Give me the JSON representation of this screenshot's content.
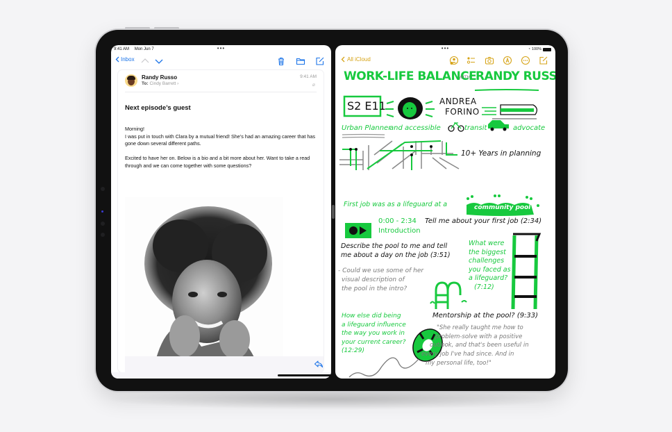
{
  "mail": {
    "status_time": "9:41 AM",
    "status_date": "Mon Jun 7",
    "multitask_dots": "•••",
    "toolbar": {
      "back_label": "Inbox",
      "prev_icon": "chevron-up-icon",
      "next_icon": "chevron-down-icon",
      "trash_icon": "trash-icon",
      "folder_icon": "folder-icon",
      "compose_icon": "compose-icon"
    },
    "message": {
      "sender": "Randy Russo",
      "to_label": "To:",
      "recipient": "Cindy Barrett",
      "time": "9:41 AM",
      "subject": "Next episode’s guest",
      "paragraphs": [
        "Morning!\nI was put in touch with Clara by a mutual friend! She’s had an amazing career that has gone down several different paths.",
        "Excited to have her on. Below is a bio and a bit more about her. Want to take a read through and we can come together with some questions?"
      ],
      "reply_icon": "reply-icon"
    }
  },
  "notes": {
    "multitask_dots": "•••",
    "battery": "100%",
    "toolbar": {
      "back_label": "All iCloud",
      "collab_icon": "collaborate-icon",
      "checklist_icon": "checklist-icon",
      "camera_icon": "camera-icon",
      "markup_icon": "markup-icon",
      "more_icon": "more-icon",
      "compose_icon": "compose-icon"
    },
    "sketch": {
      "title": "WORK-LIFE BALANCE",
      "with": "WITH",
      "host": "RANDY RUSSO",
      "episode": "S2 E11",
      "guest_line1": "ANDREA",
      "guest_line2": "FORINO",
      "role_a": "Urban Planner",
      "role_b": "and accessible",
      "role_c": "transit",
      "role_d": "advocate",
      "years": "10+ Years in planning",
      "first_job": "First job was as a lifeguard at a",
      "pool_badge": "community pool",
      "intro_time": "0:00 - 2:34",
      "intro_label": "Introduction",
      "q1": "Tell me about your first job (2:34)",
      "q2_line1": "Describe the pool to me and tell",
      "q2_line2": "me about a day on the job (3:51)",
      "note_lines": [
        "- Could we use some of her",
        "visual description of",
        "the pool in the intro?"
      ],
      "q3_lines": [
        "What were",
        "the biggest",
        "challenges",
        "you faced as",
        "a lifeguard?",
        "(7:12)"
      ],
      "q4": "Mentorship at the pool? (9:33)",
      "q5_lines": [
        "How else did being",
        "a lifeguard influence",
        "the way you work in",
        "your current career?",
        "(12:29)"
      ],
      "quote_lines": [
        "\"She really taught me how to",
        "problem-solve with a positive",
        "outlook, and that's been useful in",
        "every job I've had since. And in",
        "my personal life, too!\""
      ]
    }
  },
  "colors": {
    "mail_accent": "#1a73e8",
    "notes_accent": "#d6a316",
    "sketch_green": "#17c93e"
  }
}
